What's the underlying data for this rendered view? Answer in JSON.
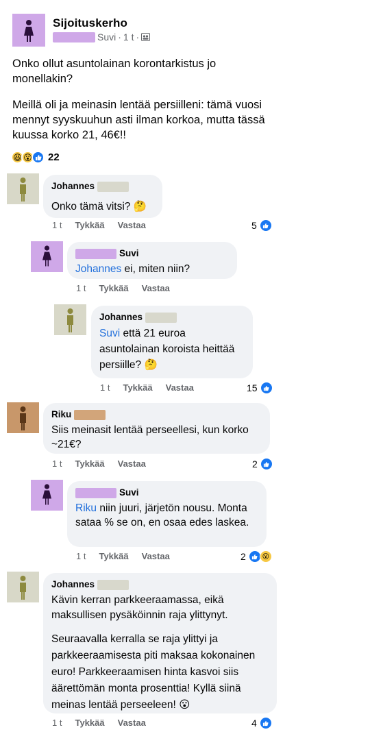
{
  "post": {
    "group": "Sijoituskerho",
    "author": "Suvi",
    "time": "1 t",
    "title_text": "Onko ollut asuntolainan korontarkistus jo monellakin?",
    "body_text": "Meillä oli ja meinasin lentää persiilleni: tämä vuosi mennyt syyskuuhun asti ilman korkoa, mutta tässä kuussa korko 21, 46€!!",
    "reaction_count": "22"
  },
  "actions": {
    "like": "Tykkää",
    "reply": "Vastaa"
  },
  "comments": [
    {
      "author": "Johannes",
      "text": "Onko tämä vitsi? 🤔",
      "time": "1 t",
      "likes": "5"
    },
    {
      "author": "Suvi",
      "mention": "Johannes",
      "text": " ei, miten niin?",
      "time": "1 t",
      "likes": ""
    },
    {
      "author": "Johannes",
      "mention": "Suvi",
      "text": " että 21 euroa asuntolainan koroista heittää persiille? 🤔",
      "time": "1 t",
      "likes": "15"
    },
    {
      "author": "Riku",
      "text": "Siis meinasit lentää perseellesi, kun korko ~21€?",
      "time": "1 t",
      "likes": "2"
    },
    {
      "author": "Suvi",
      "mention": "Riku",
      "text": " niin juuri, järjetön nousu. Monta sataa % se on, en osaa edes laskea.",
      "time": "1 t",
      "likes": "2"
    },
    {
      "author": "Johannes",
      "text": "Kävin kerran parkkeeraamassa, eikä maksullisen pysäköinnin raja ylittynyt.",
      "text2": "Seuraavalla kerralla se raja ylittyi ja parkkeeraamisesta piti maksaa kokonainen euro! Parkkeeraamisen hinta kasvoi siis äärettömän monta prosenttia! Kyllä siinä meinas lentää perseeleen! 😮",
      "time": "1 t",
      "likes": "4"
    }
  ],
  "colors": {
    "mention": "#216fdb",
    "like_blue": "#1877f2",
    "bubble": "#f0f2f5",
    "purple_avatar": "#cfa8e8",
    "olive_avatar": "#d8d8c8",
    "brown_avatar": "#c8976a"
  }
}
